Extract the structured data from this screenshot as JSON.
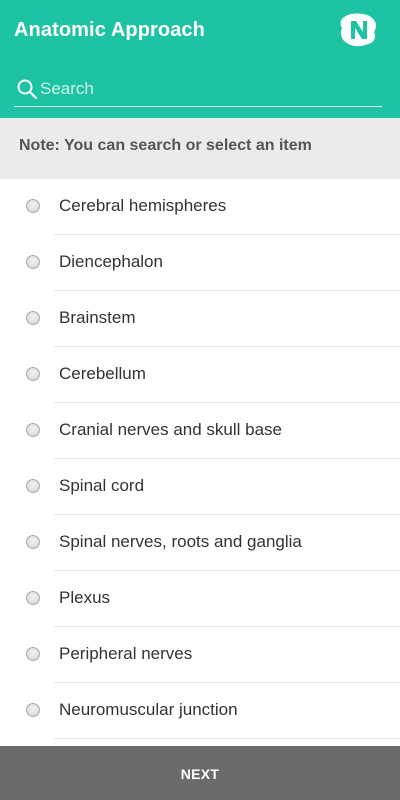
{
  "header": {
    "title": "Anatomic Approach",
    "logo_icon": "brand-n-logo",
    "background_color": "#1ec3a4"
  },
  "search": {
    "placeholder": "Search",
    "value": "",
    "icon": "search-icon"
  },
  "note": {
    "text": "Note: You can search or select an item"
  },
  "options": [
    {
      "label": "Cerebral hemispheres",
      "selected": false
    },
    {
      "label": "Diencephalon",
      "selected": false
    },
    {
      "label": "Brainstem",
      "selected": false
    },
    {
      "label": "Cerebellum",
      "selected": false
    },
    {
      "label": "Cranial nerves and skull base",
      "selected": false
    },
    {
      "label": "Spinal cord",
      "selected": false
    },
    {
      "label": "Spinal nerves, roots and ganglia",
      "selected": false
    },
    {
      "label": "Plexus",
      "selected": false
    },
    {
      "label": "Peripheral nerves",
      "selected": false
    },
    {
      "label": "Neuromuscular junction",
      "selected": false
    }
  ],
  "footer": {
    "next_label": "NEXT",
    "button_color": "#6b6b6b"
  }
}
